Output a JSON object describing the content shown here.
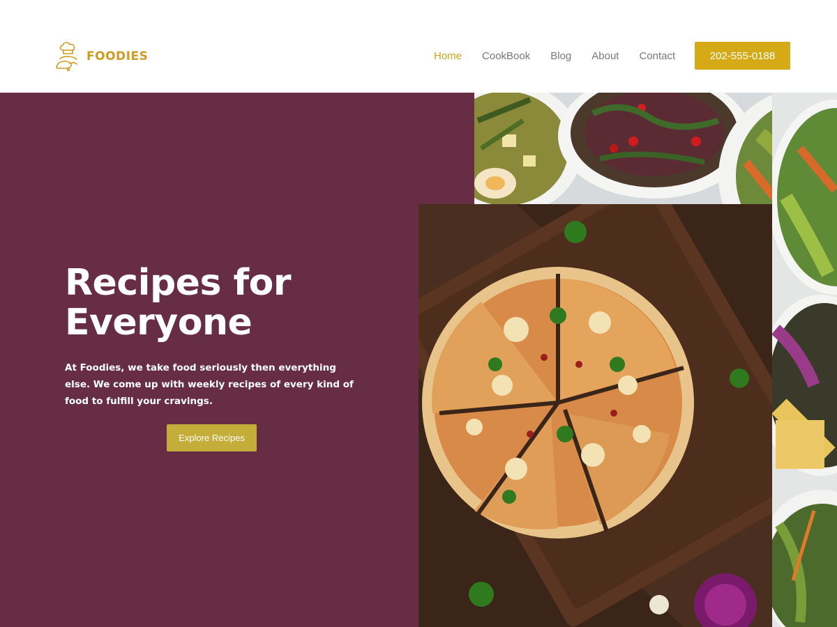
{
  "brand": {
    "name": "FOODIES",
    "logo_icon": "chef-hat-icon",
    "color": "#cf9a1f"
  },
  "nav": {
    "items": [
      {
        "label": "Home",
        "active": true
      },
      {
        "label": "CookBook",
        "active": false
      },
      {
        "label": "Blog",
        "active": false
      },
      {
        "label": "About",
        "active": false
      },
      {
        "label": "Contact",
        "active": false
      }
    ],
    "phone": "202-555-0188"
  },
  "hero": {
    "title_line1": "Recipes for",
    "title_line2": "Everyone",
    "subtitle": "At Foodies, we take food seriously then everything else. We come up with weekly recipes of every kind of food to fulfill your cravings.",
    "cta": "Explore Recipes",
    "background": "#672d45",
    "accent": "#c5ad3a"
  },
  "images": {
    "salad": "salad-bowls-photo",
    "pizza": "pizza-on-board-photo"
  }
}
